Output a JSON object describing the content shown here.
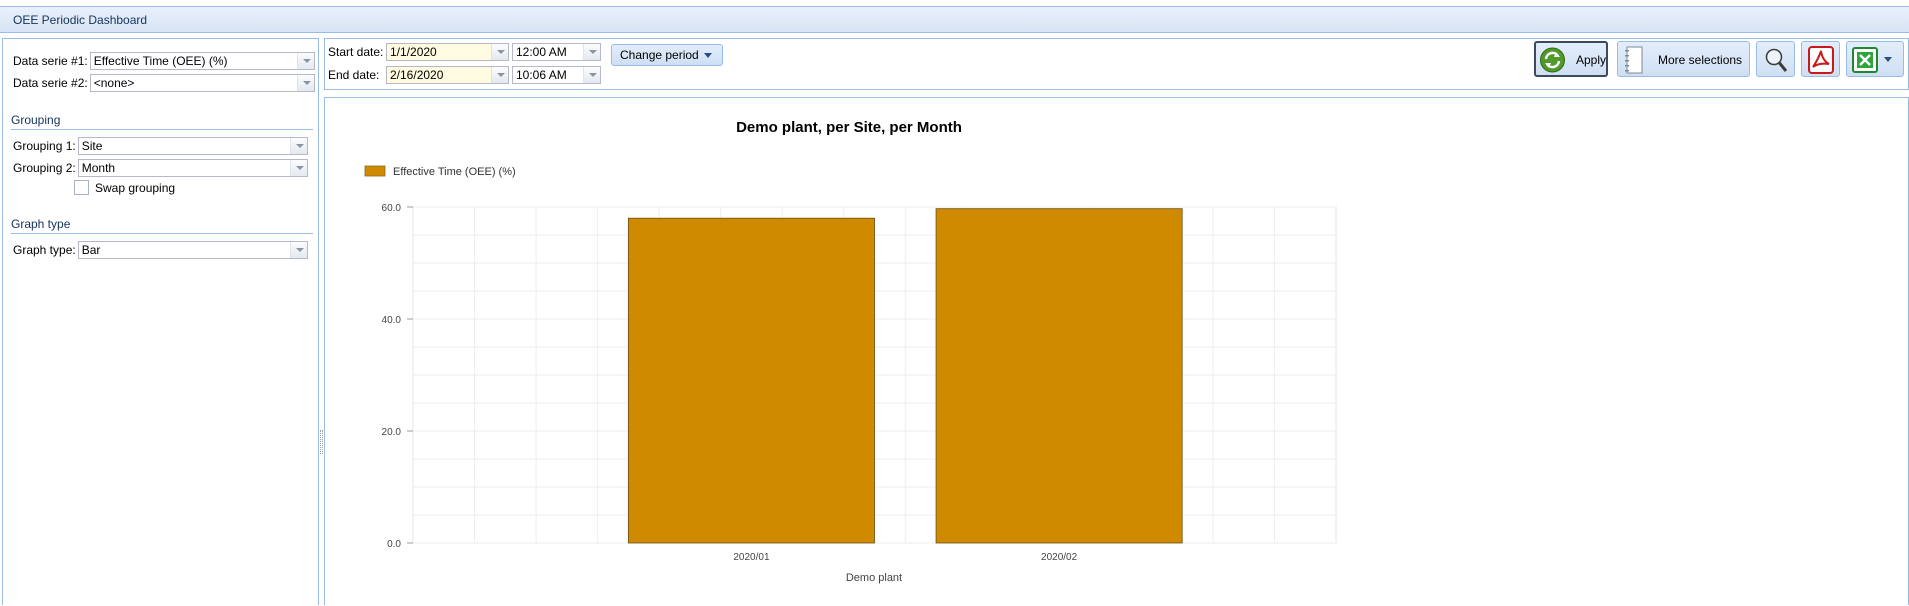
{
  "window": {
    "title": "OEE Periodic Dashboard"
  },
  "left_panel": {
    "data_serie_1": {
      "label": "Data serie #1:",
      "value": "Effective Time (OEE) (%)"
    },
    "data_serie_2": {
      "label": "Data serie #2:",
      "value": "<none>"
    },
    "grouping": {
      "heading": "Grouping",
      "grouping_1": {
        "label": "Grouping 1:",
        "value": "Site"
      },
      "grouping_2": {
        "label": "Grouping 2:",
        "value": "Month"
      },
      "swap_label": "Swap grouping",
      "swap_checked": false
    },
    "graph_type": {
      "heading": "Graph type",
      "label": "Graph type:",
      "value": "Bar"
    }
  },
  "toolbar": {
    "start_date": {
      "label": "Start date:",
      "date": "1/1/2020",
      "time": "12:00 AM"
    },
    "end_date": {
      "label": "End date:",
      "date": "2/16/2020",
      "time": "10:06 AM"
    },
    "change_period_label": "Change period",
    "apply_label": "Apply",
    "more_selections_label": "More selections",
    "icons": [
      "refresh-icon",
      "notebook-icon",
      "magnifier-icon",
      "pdf-icon",
      "excel-icon"
    ]
  },
  "colors": {
    "bar": "#d08a00",
    "panel_border": "#99bbe8",
    "header_text": "#15325c"
  },
  "chart_data": {
    "type": "bar",
    "title": "Demo plant, per Site, per Month",
    "xlabel": "Demo plant",
    "ylabel": "",
    "categories": [
      "2020/01",
      "2020/02"
    ],
    "series": [
      {
        "name": "Effective Time (OEE) (%)",
        "values": [
          58.0,
          59.7
        ]
      }
    ],
    "ylim": [
      0,
      60
    ],
    "yticks": [
      "0.0",
      "20.0",
      "40.0",
      "60.0"
    ],
    "grid": true,
    "legend": "top-left"
  }
}
